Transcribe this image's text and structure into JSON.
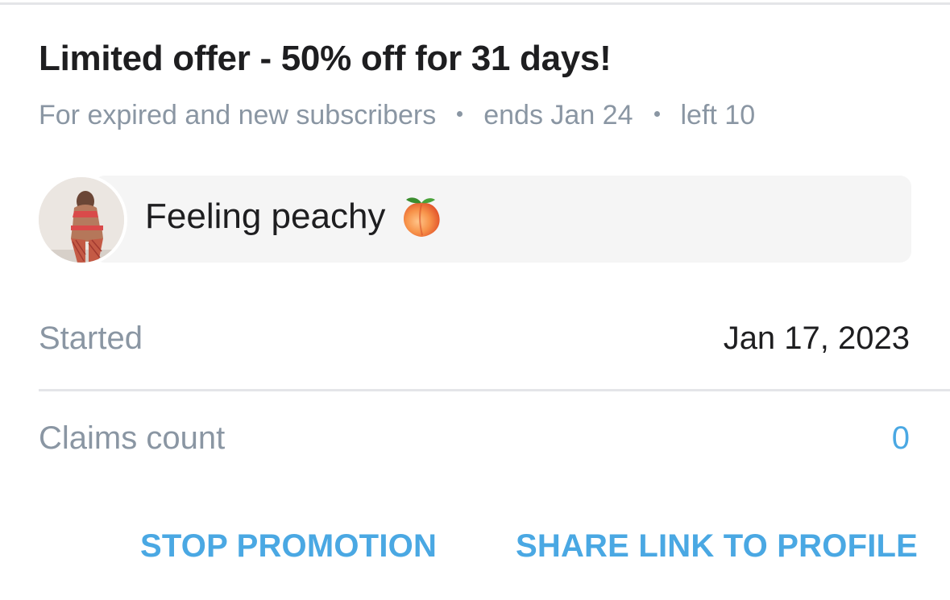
{
  "offer": {
    "title": "Limited offer - 50% off for 31 days!",
    "audience": "For expired and new subscribers",
    "ends": "ends Jan 24",
    "left": "left 10"
  },
  "message": {
    "text": "Feeling peachy",
    "emoji_icon": "peach-emoji-icon"
  },
  "details": {
    "started_label": "Started",
    "started_value": "Jan 17, 2023",
    "claims_label": "Claims count",
    "claims_value": "0"
  },
  "actions": {
    "stop_label": "STOP PROMOTION",
    "share_label": "SHARE LINK TO PROFILE"
  },
  "colors": {
    "text_primary": "#1e1e20",
    "text_muted": "#8a96a3",
    "accent_blue": "#4aa8e3",
    "card_bg": "#f5f5f5",
    "divider": "#e4e5e8"
  }
}
